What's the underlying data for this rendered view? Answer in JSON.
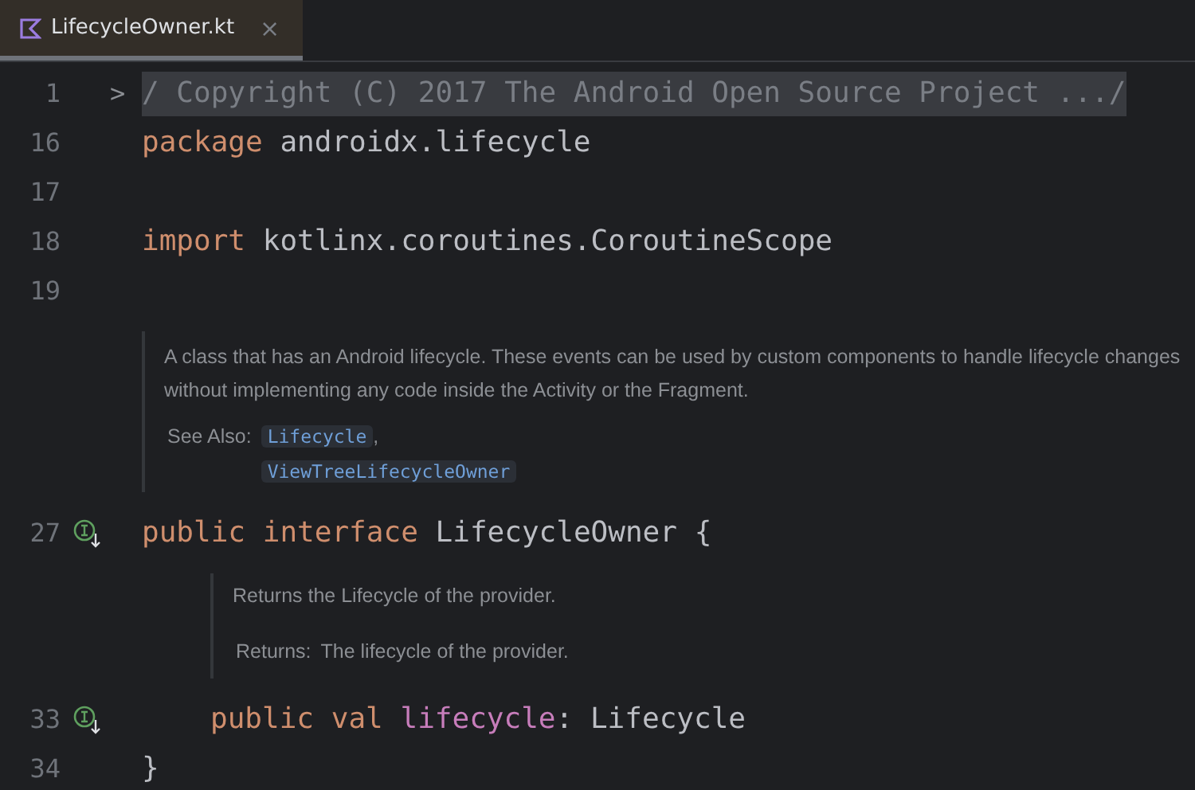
{
  "tabs": [
    {
      "label": "LifecycleOwner.kt",
      "selected": true,
      "close": "×"
    }
  ],
  "editor": {
    "blocks": [
      {
        "kind": "code",
        "number": "1",
        "fold": ">",
        "folded": true,
        "tokens": [
          {
            "kind": "comment",
            "text": "/ Copyright (C) 2017 The Android Open Source Project .../"
          }
        ]
      },
      {
        "kind": "code",
        "number": "16",
        "tokens": [
          {
            "kind": "keyword",
            "text": "package"
          },
          {
            "kind": "plain",
            "text": "androidx.lifecycle"
          }
        ]
      },
      {
        "kind": "code",
        "number": "17"
      },
      {
        "kind": "code",
        "number": "18",
        "tokens": [
          {
            "kind": "keyword",
            "text": "import"
          },
          {
            "kind": "plain",
            "text": "kotlinx.coroutines.CoroutineScope"
          }
        ]
      },
      {
        "kind": "code",
        "number": "19"
      },
      {
        "kind": "doc",
        "indented": false,
        "paragraphs": [
          "A class that has an Android lifecycle. These events can be used by custom components to handle lifecycle changes without implementing any code inside the Activity or the Fragment."
        ],
        "see_also": {
          "label": "See Also:",
          "links": [
            "Lifecycle",
            "ViewTreeLifecycleOwner"
          ],
          "separator": ","
        }
      },
      {
        "kind": "code",
        "number": "27",
        "implemented": true,
        "tokens": [
          {
            "kind": "keyword",
            "text": "public"
          },
          {
            "kind": "keyword",
            "text": "interface"
          },
          {
            "kind": "plain",
            "text": "LifecycleOwner"
          },
          {
            "kind": "plain",
            "text": "{"
          }
        ]
      },
      {
        "kind": "doc",
        "indented": true,
        "paragraphs": [
          "Returns the Lifecycle of the provider."
        ],
        "returns": {
          "label": "Returns:",
          "text": "The lifecycle of the provider."
        }
      },
      {
        "kind": "code",
        "number": "33",
        "implemented": true,
        "indented": true,
        "tokens": [
          {
            "kind": "keyword",
            "text": "public"
          },
          {
            "kind": "keyword",
            "text": "val"
          },
          {
            "kind": "property",
            "text": "lifecycle"
          },
          {
            "kind": "glue",
            "text": ":"
          },
          {
            "kind": "plain",
            "text": "Lifecycle"
          }
        ]
      },
      {
        "kind": "code",
        "number": "34",
        "tokens": [
          {
            "kind": "plain",
            "text": "}"
          }
        ]
      }
    ]
  }
}
